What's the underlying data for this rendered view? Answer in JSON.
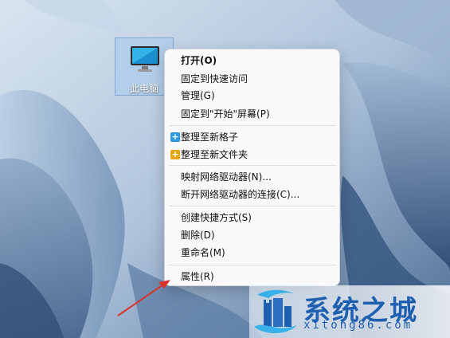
{
  "desktop": {
    "icon_label": "此电脑"
  },
  "context_menu": {
    "items": [
      {
        "label": "打开(O)"
      },
      {
        "label": "固定到快速访问"
      },
      {
        "label": "管理(G)"
      },
      {
        "label": "固定到\"开始\"屏幕(P)"
      },
      {
        "label": "整理至新格子",
        "icon": "plus-icon",
        "icon_color": "#2f9be0"
      },
      {
        "label": "整理至新文件夹",
        "icon": "plus-icon",
        "icon_color": "#e8a317"
      },
      {
        "label": "映射网络驱动器(N)..."
      },
      {
        "label": "断开网络驱动器的连接(C)..."
      },
      {
        "label": "创建快捷方式(S)"
      },
      {
        "label": "删除(D)"
      },
      {
        "label": "重命名(M)"
      },
      {
        "label": "属性(R)"
      }
    ]
  },
  "watermark": {
    "title": "系统之城",
    "url": "xitong86.com",
    "color": "#1f5fb0"
  },
  "annotation": {
    "arrow_color": "#d9342b"
  }
}
